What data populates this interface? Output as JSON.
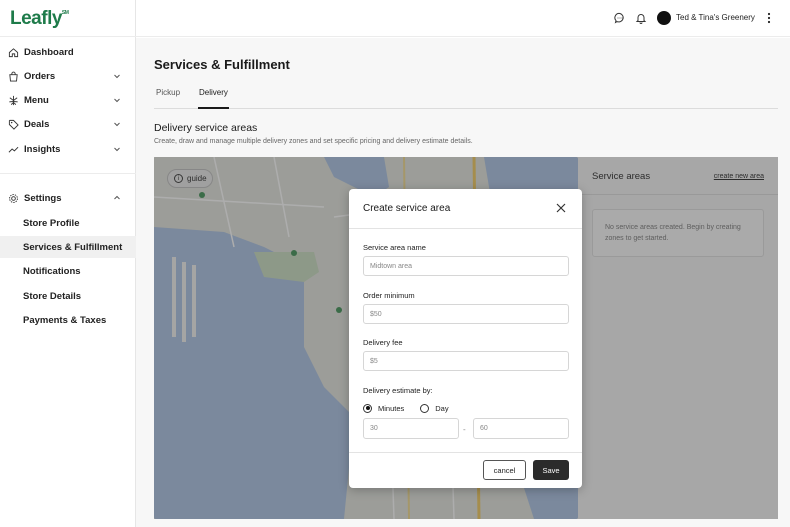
{
  "app": {
    "logo": "Leafly",
    "logo_mark": "SM"
  },
  "sidebar": {
    "items": [
      {
        "label": "Dashboard",
        "icon": "home-icon"
      },
      {
        "label": "Orders",
        "icon": "bag-icon"
      },
      {
        "label": "Menu",
        "icon": "cannabis-leaf-icon"
      },
      {
        "label": "Deals",
        "icon": "tag-icon"
      },
      {
        "label": "Insights",
        "icon": "trend-icon"
      }
    ],
    "settings": {
      "label": "Settings",
      "icon": "gear-icon"
    },
    "settings_items": [
      {
        "label": "Store Profile"
      },
      {
        "label": "Services & Fulfillment"
      },
      {
        "label": "Notifications"
      },
      {
        "label": "Store Details"
      },
      {
        "label": "Payments & Taxes"
      }
    ]
  },
  "topbar": {
    "store_name": "Ted & Tina's Greenery"
  },
  "page": {
    "title": "Services & Fulfillment",
    "tabs": [
      {
        "label": "Pickup"
      },
      {
        "label": "Delivery"
      }
    ],
    "section_title": "Delivery service areas",
    "section_desc": "Create, draw and manage multiple delivery zones and set specific pricing and delivery estimate details."
  },
  "map": {
    "guide_label": "guide"
  },
  "service_areas": {
    "title": "Service areas",
    "create_link": "create new area",
    "empty_text": "No service areas created. Begin by creating zones to get started."
  },
  "modal": {
    "title": "Create service area",
    "name_label": "Service area name",
    "name_placeholder": "Midtown area",
    "minimum_label": "Order minimum",
    "minimum_placeholder": "$50",
    "fee_label": "Delivery fee",
    "fee_placeholder": "$5",
    "estimate_label": "Delivery estimate by:",
    "radio_minutes": "Minutes",
    "radio_day": "Day",
    "est_min_placeholder": "30",
    "est_separator": "-",
    "est_max_placeholder": "60",
    "cancel_label": "cancel",
    "save_label": "Save"
  }
}
